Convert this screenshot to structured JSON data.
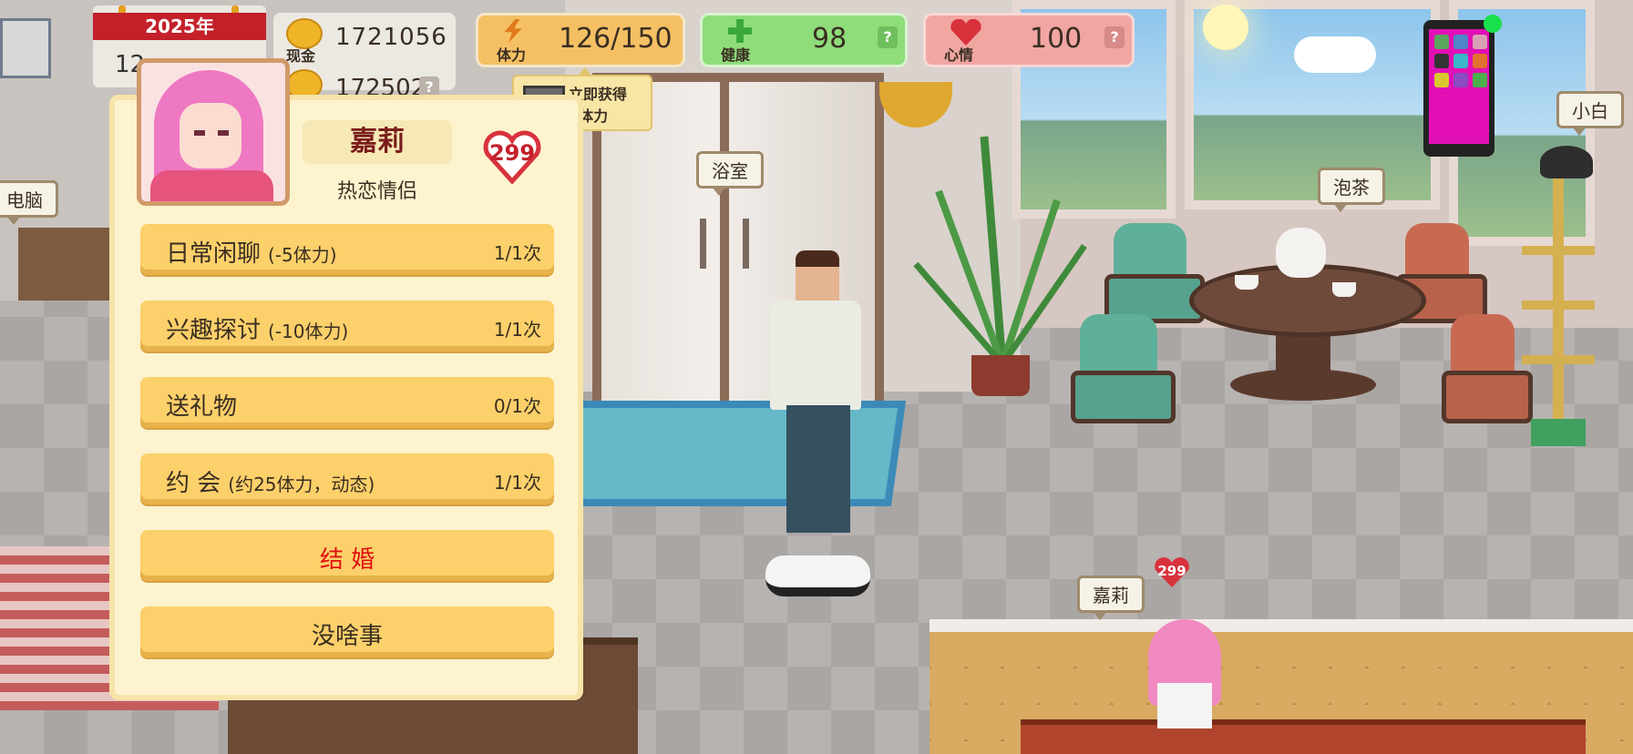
{
  "hud": {
    "year": "2025年",
    "date": "12",
    "money_label": "现金",
    "money_value": "1721056",
    "money_value2": "172502",
    "energy": {
      "label": "体力",
      "value": "126/150"
    },
    "health": {
      "label": "健康",
      "value": "98"
    },
    "mood": {
      "label": "心情",
      "value": "100"
    },
    "help": "?",
    "tooltip": {
      "line1": "立即获得",
      "line2": "0体力"
    }
  },
  "scene_tags": {
    "bathroom": "浴室",
    "tea": "泡茶",
    "cat": "小白",
    "computer": "电脑",
    "girl": "嘉莉",
    "girl_hearts": "299"
  },
  "panel": {
    "name": "嘉莉",
    "relation": "热恋情侣",
    "hearts": "299",
    "options": [
      {
        "label": "日常闲聊",
        "cost": "(-5体力)",
        "count": "1/1次"
      },
      {
        "label": "兴趣探讨",
        "cost": "(-10体力)",
        "count": "1/1次"
      },
      {
        "label": "送礼物",
        "cost": "",
        "count": "0/1次"
      },
      {
        "label": "约 会",
        "cost": "(约25体力，动态)",
        "count": "1/1次"
      }
    ],
    "marry": "结 婚",
    "nothing": "没啥事"
  },
  "colors": {
    "marry_text": "#e01010",
    "button": "#fcd06a",
    "panel_bg": "#fdf3cf",
    "phone_screen": "#e20fb5"
  }
}
